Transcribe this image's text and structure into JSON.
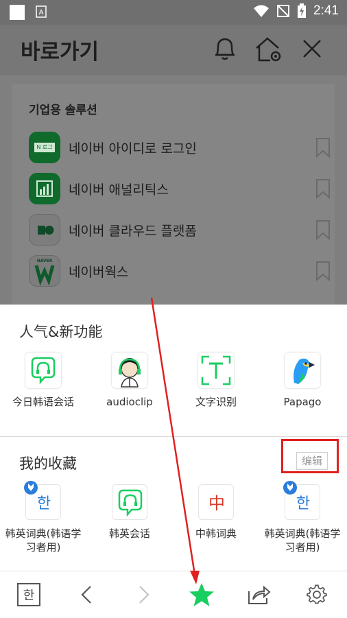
{
  "status_bar": {
    "time": "2:41"
  },
  "background_app": {
    "title": "바로가기",
    "section_title": "기업용 솔루션",
    "items": [
      {
        "label": "네이버 아이디로 로그인",
        "logo_text": "N 로그인"
      },
      {
        "label": "네이버 애널리틱스"
      },
      {
        "label": "네이버 클라우드 플랫폼"
      },
      {
        "label": "네이버웍스",
        "logo_text": "NAVER"
      }
    ]
  },
  "sheet": {
    "popular_title": "人气&新功能",
    "popular_apps": [
      {
        "label": "今日韩语会话"
      },
      {
        "label": "audioclip"
      },
      {
        "label": "文字识别"
      },
      {
        "label": "Papago"
      }
    ],
    "favorites_title": "我的收藏",
    "edit_label": "编辑",
    "favorites": [
      {
        "label": "韩英词典(韩语学习者用)",
        "icon_char": "한"
      },
      {
        "label": "韩英会话"
      },
      {
        "label": "中韩词典",
        "icon_char": "中"
      },
      {
        "label": "韩英词典(韩语学习者用)",
        "icon_char": "한"
      }
    ]
  },
  "toolbar": {
    "hangul_label": "한"
  },
  "colors": {
    "naver_green": "#19ce60",
    "annotation_red": "#e02020",
    "hangul_blue": "#2a7ddb"
  }
}
